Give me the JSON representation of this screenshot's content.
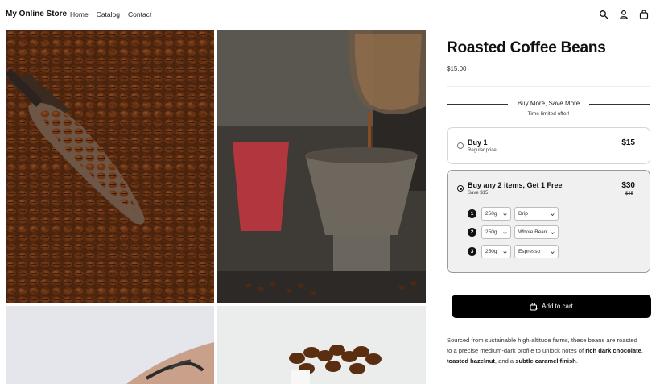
{
  "header": {
    "brand": "My Online Store",
    "nav": [
      "Home",
      "Catalog",
      "Contact"
    ],
    "icons": [
      "search-icon",
      "account-icon",
      "cart-bag-icon"
    ]
  },
  "gallery": {
    "images": [
      "coffee-beans-scoop-image",
      "coffee-pour-over-image",
      "tattooed-arm-image",
      "coffee-beans-closeup-image"
    ]
  },
  "product": {
    "title": "Roasted Coffee Beans",
    "price": "$15.00",
    "bundle": {
      "heading": "Buy More, Save More",
      "subheading": "Time-limited offer!"
    },
    "options": [
      {
        "title": "Buy 1",
        "subtitle": "Regular price",
        "price": "$15",
        "selected": false
      },
      {
        "title": "Buy any 2 items, Get 1 Free",
        "subtitle": "Save $15",
        "price": "$30",
        "compare_price": "$45",
        "selected": true,
        "items": [
          {
            "number": "1",
            "weight": "250g",
            "grind": "Drip"
          },
          {
            "number": "2",
            "weight": "250g",
            "grind": "Whole Bean"
          },
          {
            "number": "3",
            "weight": "250g",
            "grind": "Espresso"
          }
        ]
      }
    ],
    "add_to_cart": "Add to cart",
    "description": {
      "prefix": "Sourced from sustainable high-altitude farms, these beans are roasted to a precise medium-dark profile to unlock notes of ",
      "note1": "rich dark chocolate",
      "sep1": ", ",
      "note2": "toasted hazelnut",
      "sep2": ", and a ",
      "note3": "subtle caramel finish",
      "suffix": "."
    }
  },
  "colors": {
    "accent": "#000000",
    "selected_bg": "#f0f0f0",
    "border": "#d6d6d6"
  }
}
